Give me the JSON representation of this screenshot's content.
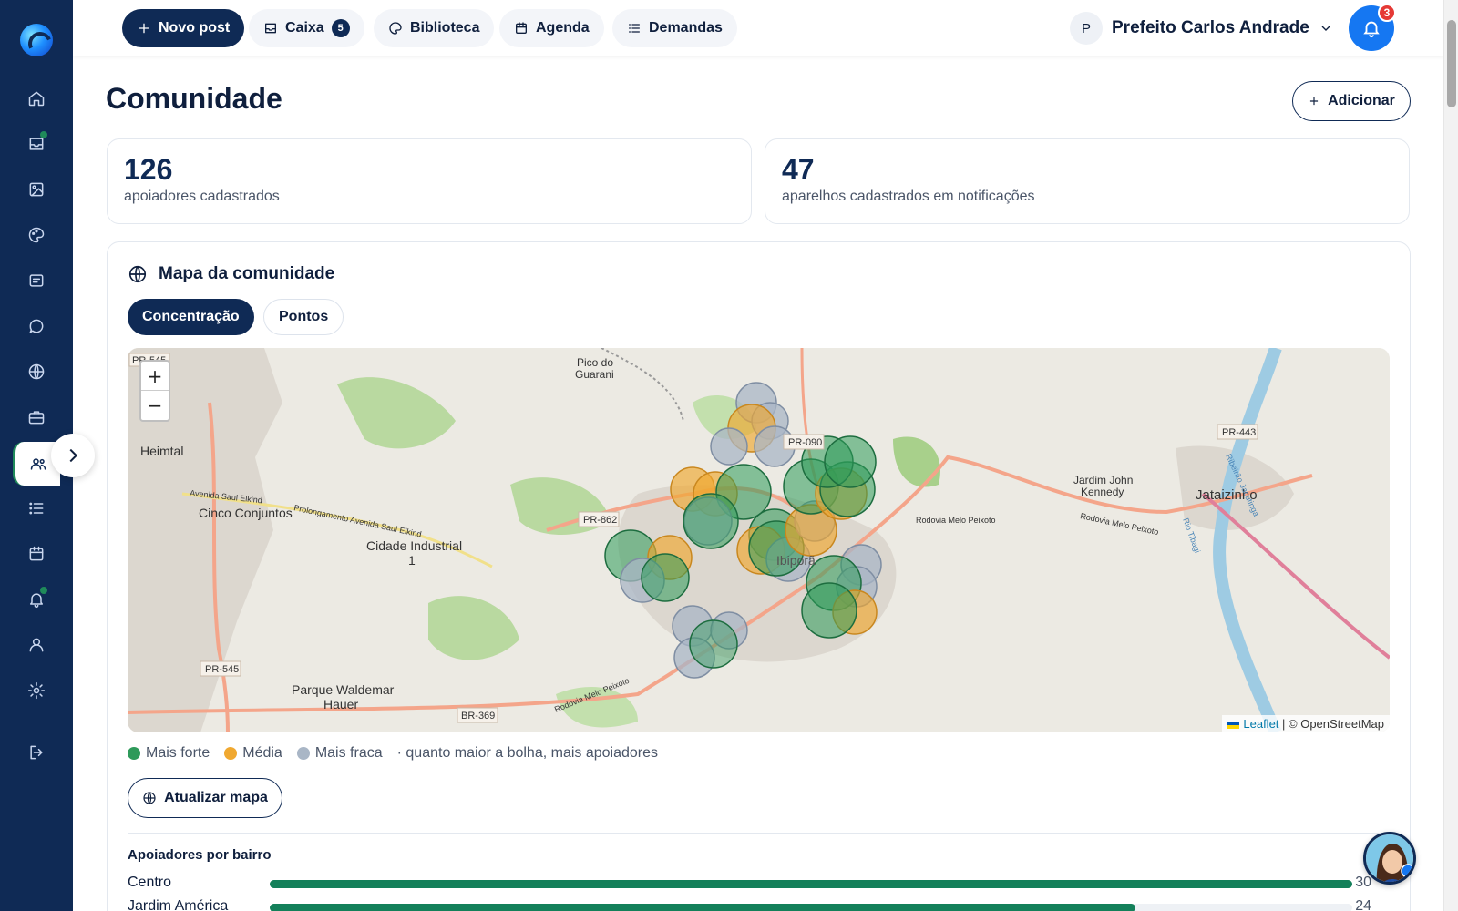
{
  "topbar": {
    "new_post": "Novo post",
    "inbox": "Caixa",
    "inbox_count": "5",
    "library": "Biblioteca",
    "agenda": "Agenda",
    "demands": "Demandas",
    "profile_initial": "P",
    "profile_name": "Prefeito Carlos Andrade",
    "notifications_count": "3"
  },
  "page": {
    "title": "Comunidade",
    "add_button": "Adicionar"
  },
  "stats": [
    {
      "value": "126",
      "label": "apoiadores cadastrados"
    },
    {
      "value": "47",
      "label": "aparelhos cadastrados em notificações"
    }
  ],
  "map_section": {
    "title": "Mapa da comunidade",
    "tabs": [
      "Concentração",
      "Pontos"
    ],
    "active_tab": "Concentração",
    "zoom_in": "+",
    "zoom_out": "−",
    "attribution_link": "Leaflet",
    "attribution_rest": " | © OpenStreetMap",
    "labels": {
      "pico": "Pico do",
      "guarani": "Guarani",
      "heimtal": "Heimtal",
      "cinco": "Cinco Conjuntos",
      "cidade": "Cidade Industrial",
      "um": "1",
      "parque": "Parque Waldemar",
      "hauer": "Hauer",
      "jardim1": "Jardim John",
      "jardim2": "Kennedy",
      "jataizinho": "Jataizinho",
      "ibipora": "Ibiporã",
      "pr862": "PR-862",
      "pr545": "PR-545",
      "pr545b": "PR-545",
      "pr090": "PR-090",
      "pr443": "PR-443",
      "br369": "BR-369",
      "rodovia1": "Rodovia Melo Peixoto",
      "rodovia2": "Rodovia Melo Peixoto",
      "rodovia3": "Rodovia Melo Peixoto",
      "avenida1": "Avenida Saul Elkind",
      "avenida2": "Prolongamento Avenida Saul Elkind",
      "rio": "Rio Tibagi",
      "ribeirao": "Ribeirão Jacutinga"
    },
    "legend": {
      "strong": "Mais forte",
      "medium": "Média",
      "weak": "Mais fraca",
      "note": "· quanto maior a bolha, mais apoiadores"
    },
    "colors": {
      "strong": "#2e9a5a",
      "medium": "#f0a830",
      "weak": "#a9b6c6"
    },
    "refresh_button": "Atualizar mapa"
  },
  "bairros": {
    "title": "Apoiadores por bairro",
    "rows": [
      {
        "name": "Centro",
        "count": "30",
        "fraction": 1.0
      },
      {
        "name": "Jardim América",
        "count": "24",
        "fraction": 0.8
      }
    ]
  },
  "icons": {
    "sidebar": [
      "home-icon",
      "inbox-icon",
      "image-icon",
      "palette-icon",
      "news-icon",
      "chat-icon",
      "globe-icon",
      "briefcase-icon",
      "users-icon",
      "list-icon",
      "calendar-icon",
      "bell-icon",
      "user-icon",
      "settings-icon",
      "logout-icon"
    ]
  }
}
